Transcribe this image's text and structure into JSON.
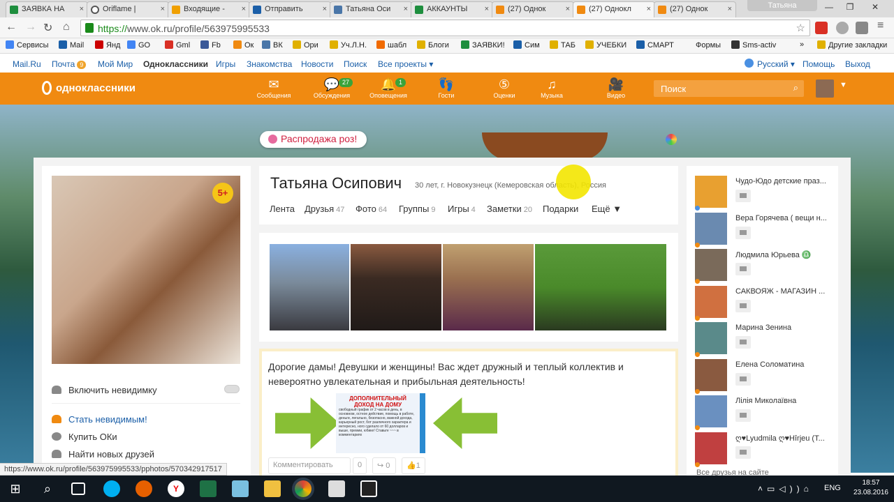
{
  "browser": {
    "tabs": [
      {
        "label": "ЗАЯВКА НА",
        "color": "#1e8e3e"
      },
      {
        "label": "Oriflame |",
        "color": "#555555"
      },
      {
        "label": "Входящие -",
        "color": "#f0a000"
      },
      {
        "label": "Отправить",
        "color": "#1b5fa8"
      },
      {
        "label": "Татьяна Оси",
        "color": "#4a76a8"
      },
      {
        "label": "АККАУНТЫ",
        "color": "#1e8e3e"
      },
      {
        "label": "(27) Однок",
        "color": "#f08a11"
      },
      {
        "label": "(27) Однокл",
        "color": "#f08a11"
      },
      {
        "label": "(27) Однок",
        "color": "#f08a11"
      }
    ],
    "user_tab": "Татьяна",
    "url_scheme": "https://",
    "url_rest": "www.ok.ru/profile/563975995533",
    "bookmarks": [
      {
        "label": "Сервисы",
        "color": "#4285f4"
      },
      {
        "label": "Mail",
        "color": "#1b5fa8"
      },
      {
        "label": "Янд",
        "color": "#cc0000"
      },
      {
        "label": "GO",
        "color": "#4285f4"
      },
      {
        "label": "Gml",
        "color": "#d93025"
      },
      {
        "label": "Fb",
        "color": "#3b5998"
      },
      {
        "label": "Ок",
        "color": "#f08a11"
      },
      {
        "label": "ВК",
        "color": "#4a76a8"
      },
      {
        "label": "Ори",
        "color": "#e0b000"
      },
      {
        "label": "Уч.Л.Н.",
        "color": "#e0b000"
      },
      {
        "label": "шабл",
        "color": "#f06a00"
      },
      {
        "label": "Блоги",
        "color": "#e0b000"
      },
      {
        "label": "ЗАЯВКИ!",
        "color": "#1e8e3e"
      },
      {
        "label": "Сим",
        "color": "#1b5fa8"
      },
      {
        "label": "ТАБ",
        "color": "#e0b000"
      },
      {
        "label": "УЧЕБКИ",
        "color": "#e0b000"
      },
      {
        "label": "СМАРТ",
        "color": "#1b5fa8"
      },
      {
        "label": "Формы",
        "color": "#f6f6f6"
      },
      {
        "label": "Sms-activ",
        "color": "#333333"
      }
    ],
    "more_bookmarks": "»",
    "other_bookmarks": "Другие закладки",
    "status_url": "https://www.ok.ru/profile/563975995533/pphotos/570342917517"
  },
  "mailbar": {
    "mailru": "Mail.Ru",
    "pochta": "Почта",
    "pochta_count": "9",
    "moy_mir": "Мой Мир",
    "odnoklassniki": "Одноклассники",
    "igry": "Игры",
    "znakomstva": "Знакомства",
    "novosti": "Новости",
    "poisk": "Поиск",
    "all_projects": "Все проекты ▾",
    "language": "Русский ▾",
    "help": "Помощь",
    "logout": "Выход"
  },
  "ok": {
    "logo": "одноклассники",
    "nav": [
      {
        "label": "Сообщения",
        "icon": "✉"
      },
      {
        "label": "Обсуждения",
        "icon": "💬",
        "badge": "27"
      },
      {
        "label": "Оповещения",
        "icon": "🔔",
        "badge": "1"
      },
      {
        "label": "Гости",
        "icon": "👣"
      },
      {
        "label": "Оценки",
        "icon": "⑤"
      },
      {
        "label": "Музыка",
        "icon": "♫"
      },
      {
        "label": "Видео",
        "icon": "🎥"
      }
    ],
    "search_placeholder": "Поиск",
    "promo": "Распродажа роз!"
  },
  "profile": {
    "name": "Татьяна Осипович",
    "info": "30 лет, г. Новокузнецк (Кемеровская область), Россия",
    "photo_badge": "5+",
    "tabs": [
      {
        "label": "Лента",
        "count": ""
      },
      {
        "label": "Друзья",
        "count": "47"
      },
      {
        "label": "Фото",
        "count": "64"
      },
      {
        "label": "Группы",
        "count": "9"
      },
      {
        "label": "Игры",
        "count": "4"
      },
      {
        "label": "Заметки",
        "count": "20"
      },
      {
        "label": "Подарки",
        "count": ""
      },
      {
        "label": "Ещё ▼",
        "count": ""
      }
    ],
    "side_options": [
      {
        "label": "Включить невидимку"
      },
      {
        "label": "Стать невидимым!"
      },
      {
        "label": "Купить ОКи"
      },
      {
        "label": "Найти новых друзей"
      }
    ]
  },
  "post": {
    "text": "Дорогие дамы! Девушки и женщины!  Вас ждет дружный и теплый коллектив и невероятно увлекательная и прибыльная деятельность!",
    "flyer_title": "ДОПОЛНИТЕЛЬНЫЙ ДОХОД НА ДОМУ",
    "flyer_body": "свободный график от 2 часов в день, в основном, остное действие, помощь в работе, деньги, легально, безопасно, важной дохода, карьерный рост, бот различного характера и интересно, ного сделало от 60 долларов и выше, премии, юбике! Ставьте ~~~ в комментариях",
    "comment": "Комментировать",
    "comment_count": "0",
    "share_count": "0",
    "like_count": "1"
  },
  "friends": [
    {
      "name": "Чудо-Юдо детские праз...",
      "color": "#e8a030",
      "dot": "#4a90e2"
    },
    {
      "name": "Вера Горячева ( вещи н...",
      "color": "#6a8ab0",
      "dot": "#f08a11"
    },
    {
      "name": "Людмила Юрьева ♎",
      "color": "#7a6a5a",
      "dot": "#f08a11"
    },
    {
      "name": "САКВОЯЖ - МАГАЗИН ...",
      "color": "#d07040",
      "dot": "#f08a11"
    },
    {
      "name": "Марина Зенина",
      "color": "#5a8a8a",
      "dot": "#f08a11"
    },
    {
      "name": "Елена Соломатина",
      "color": "#8a5a40",
      "dot": "#f08a11"
    },
    {
      "name": "Лілія Миколаївна",
      "color": "#6a90c0",
      "dot": "#f08a11"
    },
    {
      "name": "ღ♥Lyudmila ღ♥Hîrjeu (T...",
      "color": "#c04040",
      "dot": "#f08a11"
    }
  ],
  "all_friends": "Все друзья на сайте",
  "taskbar": {
    "time": "18:57",
    "date": "23.08.2016",
    "lang": "ENG"
  }
}
